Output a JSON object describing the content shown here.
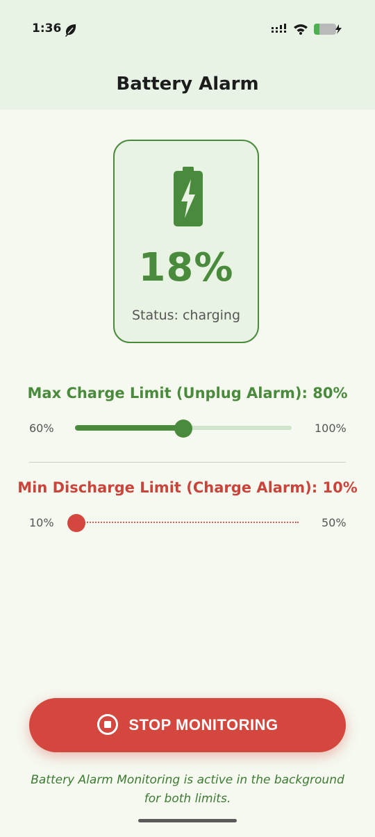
{
  "status_bar": {
    "time": "1:36",
    "icons": [
      "leaf-icon",
      "signal-icon",
      "wifi-icon",
      "battery-charging-icon"
    ]
  },
  "app": {
    "title": "Battery Alarm"
  },
  "battery_card": {
    "icon": "battery-charging-icon",
    "percent_text": "18%",
    "status_text": "Status: charging",
    "accent_color": "#4a8a3c"
  },
  "max_limit": {
    "label": "Max Charge Limit (Unplug Alarm): 80%",
    "min_label": "60%",
    "max_label": "100%",
    "value": 80,
    "range": [
      60,
      100
    ],
    "color": "#4a8a3c"
  },
  "min_limit": {
    "label": "Min Discharge Limit (Charge Alarm): 10%",
    "min_label": "10%",
    "max_label": "50%",
    "value": 10,
    "range": [
      10,
      50
    ],
    "color": "#c9443b"
  },
  "stop_button": {
    "label": "STOP MONITORING",
    "icon": "stop-circle-icon",
    "color": "#d4473e"
  },
  "footer": {
    "text": "Battery Alarm Monitoring is active in the background for both limits."
  }
}
